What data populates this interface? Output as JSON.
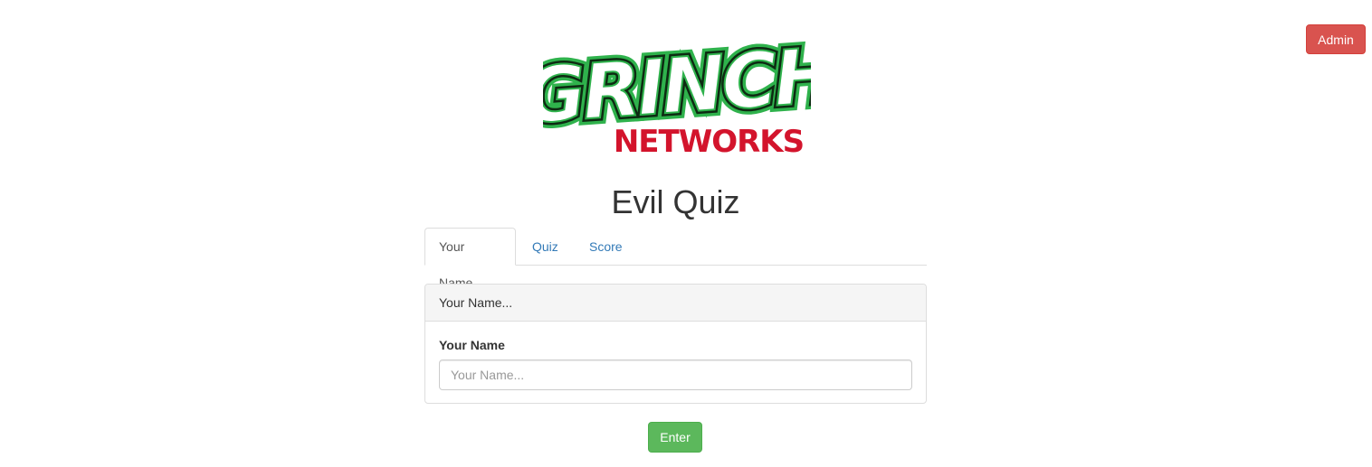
{
  "header": {
    "admin_label": "Admin",
    "logo": {
      "line1": "GRINCH",
      "line2": "NETWORKS",
      "colors": {
        "outline": "#0d2a12",
        "green": "#2fb24c",
        "red": "#d3142c"
      }
    }
  },
  "page": {
    "title": "Evil Quiz"
  },
  "tabs": [
    {
      "label": "Your Name",
      "active": true
    },
    {
      "label": "Quiz",
      "active": false
    },
    {
      "label": "Score",
      "active": false
    }
  ],
  "panel": {
    "heading": "Your Name...",
    "field_label": "Your Name",
    "input": {
      "value": "",
      "placeholder": "Your Name..."
    }
  },
  "actions": {
    "enter_label": "Enter"
  },
  "colors": {
    "danger": "#d9534f",
    "success": "#5cb85c",
    "link": "#337ab7"
  }
}
